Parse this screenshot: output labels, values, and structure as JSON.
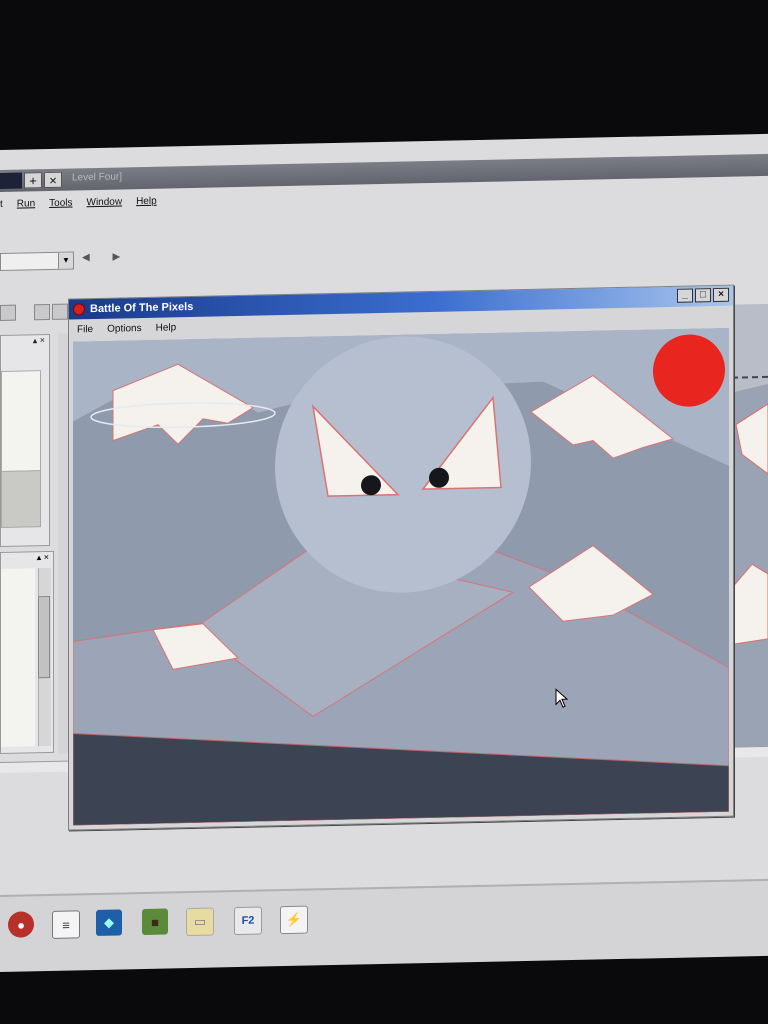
{
  "ide": {
    "title": "Level Four]",
    "title_ctrl_add": "+",
    "title_ctrl_close": "×",
    "menu": [
      "t",
      "Run",
      "Tools",
      "Window",
      "Help"
    ],
    "nav_arrows": "◀ ▶",
    "panel_ctrls": "▴ ×"
  },
  "game_window": {
    "title": "Battle Of The Pixels",
    "menu": [
      "File",
      "Options",
      "Help"
    ],
    "btn_minimize": "_",
    "btn_maximize": "□",
    "btn_close": "×"
  },
  "scene_colors": {
    "sky": "#a9b4c6",
    "sun": "#e8251f",
    "moon": "#b6bfcf",
    "ground": "#3c4454",
    "snow": "#f5f2ee"
  },
  "taskbar": {
    "icons": [
      "ruby-red-icon",
      "notepad-icon",
      "blue-app-icon",
      "grass-block-icon",
      "folder-icon",
      "browser-icon",
      "game-active-icon"
    ],
    "browser_glyph": "F2",
    "active_glyph": "⚡"
  }
}
